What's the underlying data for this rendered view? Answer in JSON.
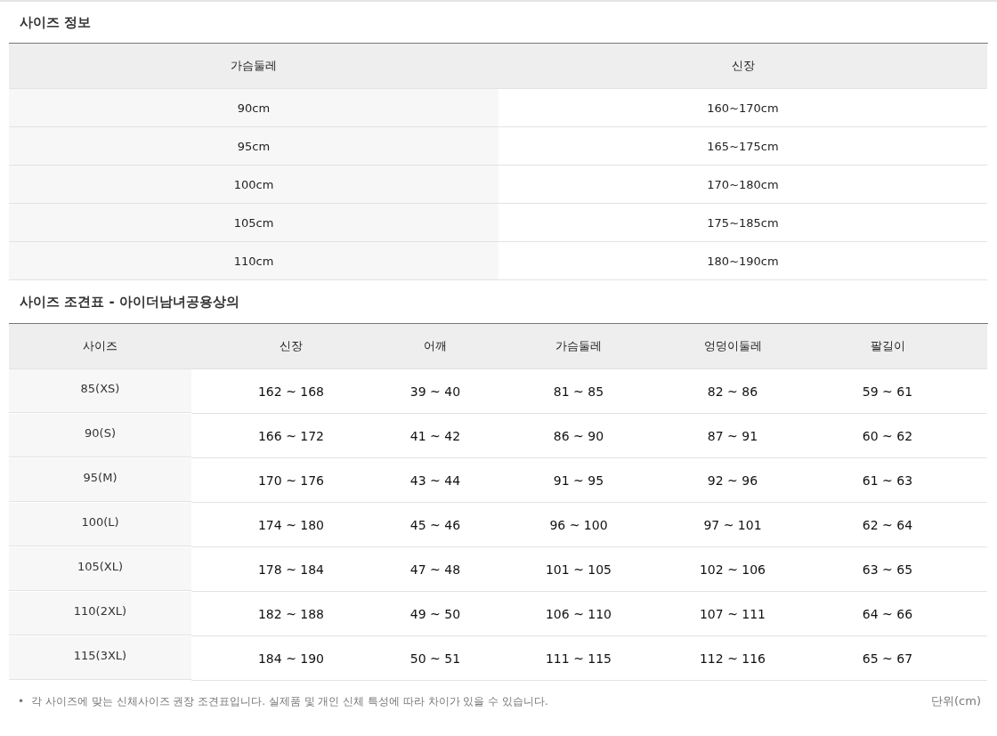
{
  "size_info": {
    "title": "사이즈 정보",
    "columns": [
      "가슴둘레",
      "신장"
    ],
    "rows": [
      [
        "90cm",
        "160~170cm"
      ],
      [
        "95cm",
        "165~175cm"
      ],
      [
        "100cm",
        "170~180cm"
      ],
      [
        "105cm",
        "175~185cm"
      ],
      [
        "110cm",
        "180~190cm"
      ]
    ]
  },
  "size_chart": {
    "title": "사이즈 조견표 - 아이더남녀공용상의",
    "columns": [
      "사이즈",
      "신장",
      "어깨",
      "가슴둘레",
      "엉덩이둘레",
      "팔길이"
    ],
    "rows": [
      [
        "85(XS)",
        "162 ~ 168",
        "39 ~ 40",
        "81 ~ 85",
        "82 ~ 86",
        "59 ~ 61"
      ],
      [
        "90(S)",
        "166 ~ 172",
        "41 ~ 42",
        "86 ~ 90",
        "87 ~ 91",
        "60 ~ 62"
      ],
      [
        "95(M)",
        "170 ~ 176",
        "43 ~ 44",
        "91 ~ 95",
        "92 ~ 96",
        "61 ~ 63"
      ],
      [
        "100(L)",
        "174 ~ 180",
        "45 ~ 46",
        "96 ~ 100",
        "97 ~ 101",
        "62 ~ 64"
      ],
      [
        "105(XL)",
        "178 ~ 184",
        "47 ~ 48",
        "101 ~ 105",
        "102 ~ 106",
        "63 ~ 65"
      ],
      [
        "110(2XL)",
        "182 ~ 188",
        "49 ~ 50",
        "106 ~ 110",
        "107 ~ 111",
        "64 ~ 66"
      ],
      [
        "115(3XL)",
        "184 ~ 190",
        "50 ~ 51",
        "111 ~ 115",
        "112 ~ 116",
        "65 ~ 67"
      ]
    ]
  },
  "footnote": {
    "bullet": "•",
    "text": "각 사이즈에 맞는 신체사이즈 권장 조견표입니다. 실제품 및 개인 신체 특성에 따라 차이가 있을 수 있습니다.",
    "unit": "단위(cm)"
  }
}
